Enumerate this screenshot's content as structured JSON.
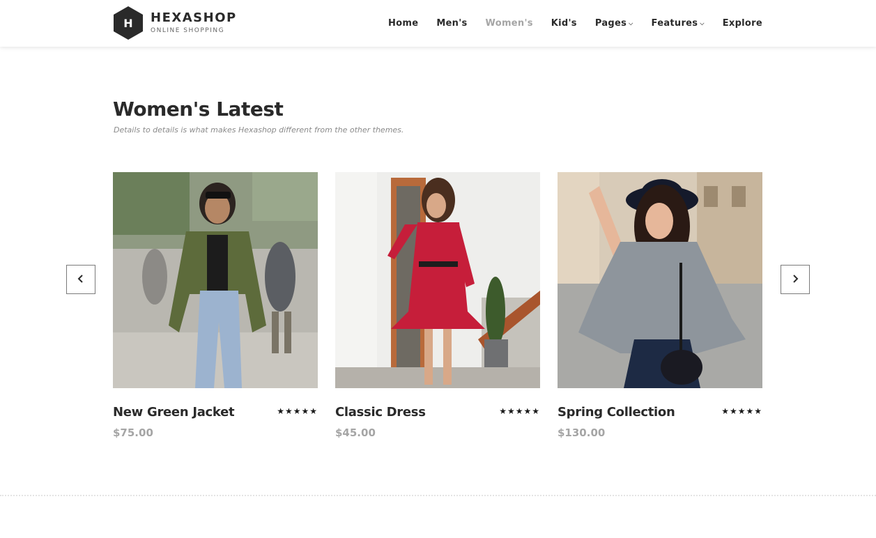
{
  "brand": {
    "name": "HEXASHOP",
    "tagline": "ONLINE SHOPPING",
    "logo_letter": "H"
  },
  "nav": {
    "items": [
      {
        "label": "Home",
        "active": false
      },
      {
        "label": "Men's",
        "active": false
      },
      {
        "label": "Women's",
        "active": true
      },
      {
        "label": "Kid's",
        "active": false
      },
      {
        "label": "Pages",
        "dropdown": true
      },
      {
        "label": "Features",
        "dropdown": true
      },
      {
        "label": "Explore",
        "active": false
      }
    ]
  },
  "section": {
    "title": "Women's Latest",
    "subtitle": "Details to details is what makes Hexashop different from the other themes."
  },
  "carousel": {
    "prev_icon": "‹",
    "next_icon": "›"
  },
  "products": [
    {
      "name": "New Green Jacket",
      "price": "$75.00",
      "stars": "★★★★★"
    },
    {
      "name": "Classic Dress",
      "price": "$45.00",
      "stars": "★★★★★"
    },
    {
      "name": "Spring Collection",
      "price": "$130.00",
      "stars": "★★★★★"
    }
  ]
}
